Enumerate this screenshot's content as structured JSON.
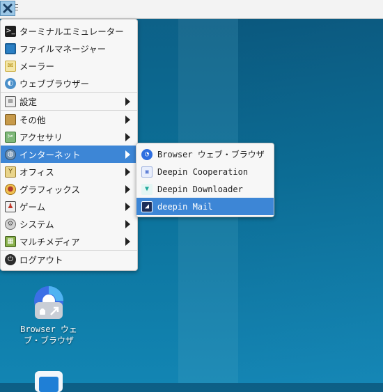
{
  "panel": {
    "app_icon": "system-menu-icon"
  },
  "main_menu": {
    "items": [
      {
        "label": "ターミナルエミュレーター",
        "icon": "terminal-icon",
        "submenu": false
      },
      {
        "label": "ファイルマネージャー",
        "icon": "file-manager-icon",
        "submenu": false
      },
      {
        "label": "メーラー",
        "icon": "mail-icon",
        "submenu": false
      },
      {
        "label": "ウェブブラウザー",
        "icon": "web-browser-icon",
        "submenu": false
      },
      {
        "label": "設定",
        "icon": "settings-icon",
        "submenu": true
      },
      {
        "label": "その他",
        "icon": "other-icon",
        "submenu": true
      },
      {
        "label": "アクセサリ",
        "icon": "accessories-icon",
        "submenu": true
      },
      {
        "label": "インターネット",
        "icon": "internet-icon",
        "submenu": true,
        "selected": true
      },
      {
        "label": "オフィス",
        "icon": "office-icon",
        "submenu": true
      },
      {
        "label": "グラフィックス",
        "icon": "graphics-icon",
        "submenu": true
      },
      {
        "label": "ゲーム",
        "icon": "games-icon",
        "submenu": true
      },
      {
        "label": "システム",
        "icon": "system-icon",
        "submenu": true
      },
      {
        "label": "マルチメディア",
        "icon": "multimedia-icon",
        "submenu": true
      },
      {
        "label": "ログアウト",
        "icon": "logout-icon",
        "submenu": false
      }
    ]
  },
  "internet_submenu": {
    "items": [
      {
        "label": "Browser ウェブ・ブラウザ",
        "icon": "browser-icon"
      },
      {
        "label": "Deepin Cooperation",
        "icon": "cooperation-icon"
      },
      {
        "label": "Deepin Downloader",
        "icon": "downloader-icon"
      },
      {
        "label": "deepin Mail",
        "icon": "deepin-mail-icon",
        "selected": true
      }
    ]
  },
  "desktop": {
    "icons": [
      {
        "label_line1": "Browser ウェ",
        "label_line2": "ブ・ブラウザ",
        "icon": "browser-desktop-icon"
      }
    ]
  },
  "colors": {
    "selection": "#3d86d6",
    "menu_bg": "#f7f7f7",
    "desktop": "#0b6f97"
  }
}
